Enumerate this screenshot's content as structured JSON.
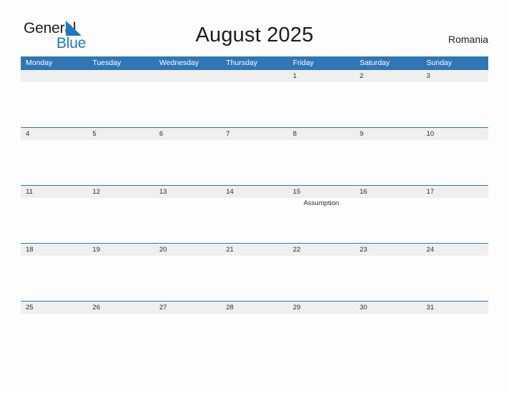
{
  "brand": {
    "name_top": "General",
    "name_bottom": "Blue",
    "flag_icon": "blue-triangle-flag-icon",
    "accent_color": "#1f78bf"
  },
  "header": {
    "title": "August 2025",
    "country": "Romania"
  },
  "theme": {
    "header_blue": "#3076b6",
    "band_gray": "#efefef",
    "page_background": "#fdfdfd",
    "text_color": "#2b2b2b"
  },
  "calendar": {
    "month": "August",
    "year": "2025",
    "weekday_headers": [
      "Monday",
      "Tuesday",
      "Wednesday",
      "Thursday",
      "Friday",
      "Saturday",
      "Sunday"
    ],
    "weeks": [
      {
        "days": [
          {
            "date": "",
            "event": ""
          },
          {
            "date": "",
            "event": ""
          },
          {
            "date": "",
            "event": ""
          },
          {
            "date": "",
            "event": ""
          },
          {
            "date": "1",
            "event": ""
          },
          {
            "date": "2",
            "event": ""
          },
          {
            "date": "3",
            "event": ""
          }
        ]
      },
      {
        "days": [
          {
            "date": "4",
            "event": ""
          },
          {
            "date": "5",
            "event": ""
          },
          {
            "date": "6",
            "event": ""
          },
          {
            "date": "7",
            "event": ""
          },
          {
            "date": "8",
            "event": ""
          },
          {
            "date": "9",
            "event": ""
          },
          {
            "date": "10",
            "event": ""
          }
        ]
      },
      {
        "days": [
          {
            "date": "11",
            "event": ""
          },
          {
            "date": "12",
            "event": ""
          },
          {
            "date": "13",
            "event": ""
          },
          {
            "date": "14",
            "event": ""
          },
          {
            "date": "15",
            "event": "Assumption"
          },
          {
            "date": "16",
            "event": ""
          },
          {
            "date": "17",
            "event": ""
          }
        ]
      },
      {
        "days": [
          {
            "date": "18",
            "event": ""
          },
          {
            "date": "19",
            "event": ""
          },
          {
            "date": "20",
            "event": ""
          },
          {
            "date": "21",
            "event": ""
          },
          {
            "date": "22",
            "event": ""
          },
          {
            "date": "23",
            "event": ""
          },
          {
            "date": "24",
            "event": ""
          }
        ]
      },
      {
        "days": [
          {
            "date": "25",
            "event": ""
          },
          {
            "date": "26",
            "event": ""
          },
          {
            "date": "27",
            "event": ""
          },
          {
            "date": "28",
            "event": ""
          },
          {
            "date": "29",
            "event": ""
          },
          {
            "date": "30",
            "event": ""
          },
          {
            "date": "31",
            "event": ""
          }
        ]
      }
    ]
  }
}
